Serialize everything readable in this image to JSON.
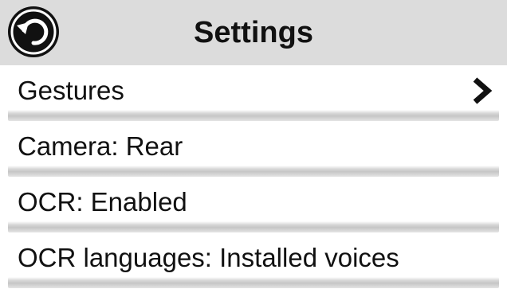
{
  "header": {
    "title": "Settings",
    "back_icon": "back-arrow-icon"
  },
  "items": [
    {
      "label": "Gestures",
      "icon": "chevron-right-icon"
    },
    {
      "label": "Camera: Rear"
    },
    {
      "label": "OCR: Enabled"
    },
    {
      "label": "OCR languages: Installed voices"
    }
  ],
  "colors": {
    "header_bg": "#dcdcdc",
    "text": "#111111",
    "background": "#ffffff"
  }
}
